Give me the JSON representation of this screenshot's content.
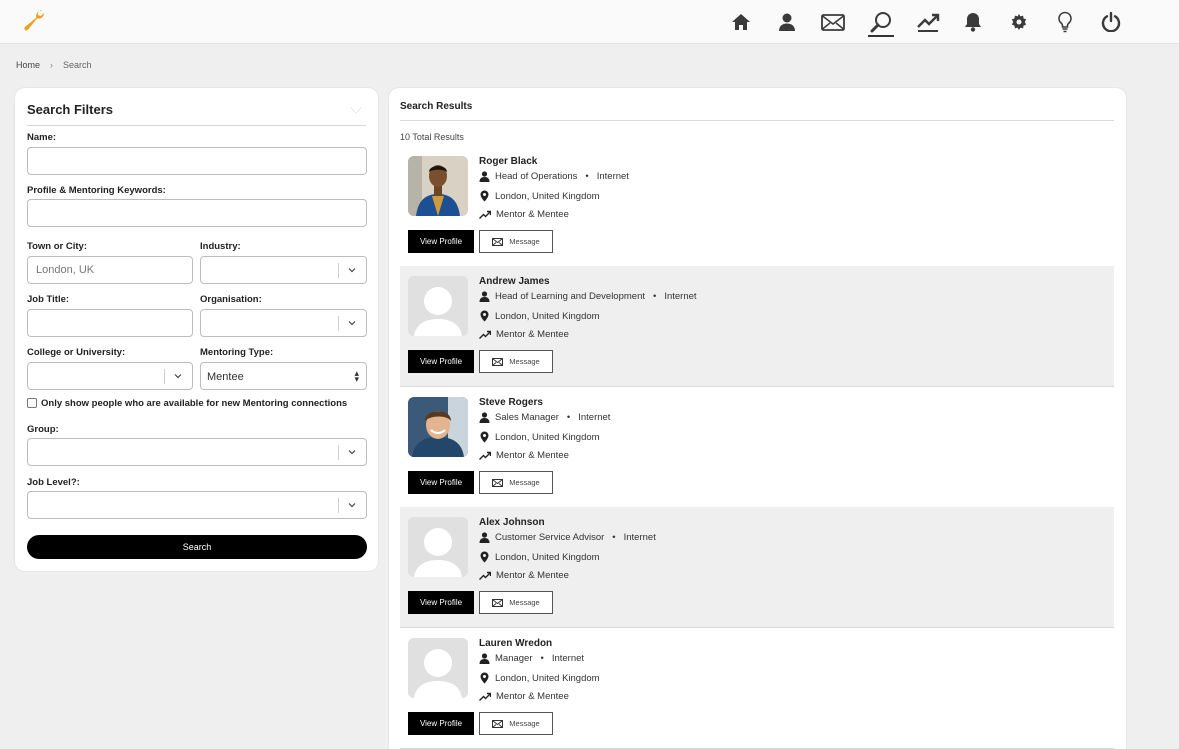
{
  "nav": {
    "items": [
      "home",
      "profile",
      "messages",
      "search",
      "analytics",
      "notifications",
      "settings",
      "ideas",
      "logout"
    ],
    "active": "search"
  },
  "breadcrumb": {
    "home": "Home",
    "current": "Search"
  },
  "filters": {
    "title": "Search Filters",
    "name_label": "Name:",
    "keywords_label": "Profile & Mentoring Keywords:",
    "town_label": "Town or City:",
    "town_placeholder": "London, UK",
    "industry_label": "Industry:",
    "job_title_label": "Job Title:",
    "organisation_label": "Organisation:",
    "college_label": "College or University:",
    "mentoring_type_label": "Mentoring Type:",
    "mentoring_type_value": "Mentee",
    "available_label": "Only show people who are available for new Mentoring connections",
    "group_label": "Group:",
    "job_level_label": "Job Level?:",
    "search_button": "Search"
  },
  "results": {
    "title": "Search Results",
    "total": "10 Total Results",
    "view_label": "View Profile",
    "message_label": "Message",
    "people": [
      {
        "name": "Roger Black",
        "role": "Head of Operations",
        "industry": "Internet",
        "location": "London, United Kingdom",
        "type": "Mentor & Mentee"
      },
      {
        "name": "Andrew James",
        "role": "Head of Learning and Development",
        "industry": "Internet",
        "location": "London, United Kingdom",
        "type": "Mentor & Mentee"
      },
      {
        "name": "Steve Rogers",
        "role": "Sales Manager",
        "industry": "Internet",
        "location": "London, United Kingdom",
        "type": "Mentor & Mentee"
      },
      {
        "name": "Alex Johnson",
        "role": "Customer Service Advisor",
        "industry": "Internet",
        "location": "London, United Kingdom",
        "type": "Mentor & Mentee"
      },
      {
        "name": "Lauren Wredon",
        "role": "Manager",
        "industry": "Internet",
        "location": "London, United Kingdom",
        "type": "Mentor & Mentee"
      }
    ]
  },
  "colors": {
    "accent": "#f0a020",
    "primary_button": "#000000",
    "alt_row": "#efefef"
  }
}
